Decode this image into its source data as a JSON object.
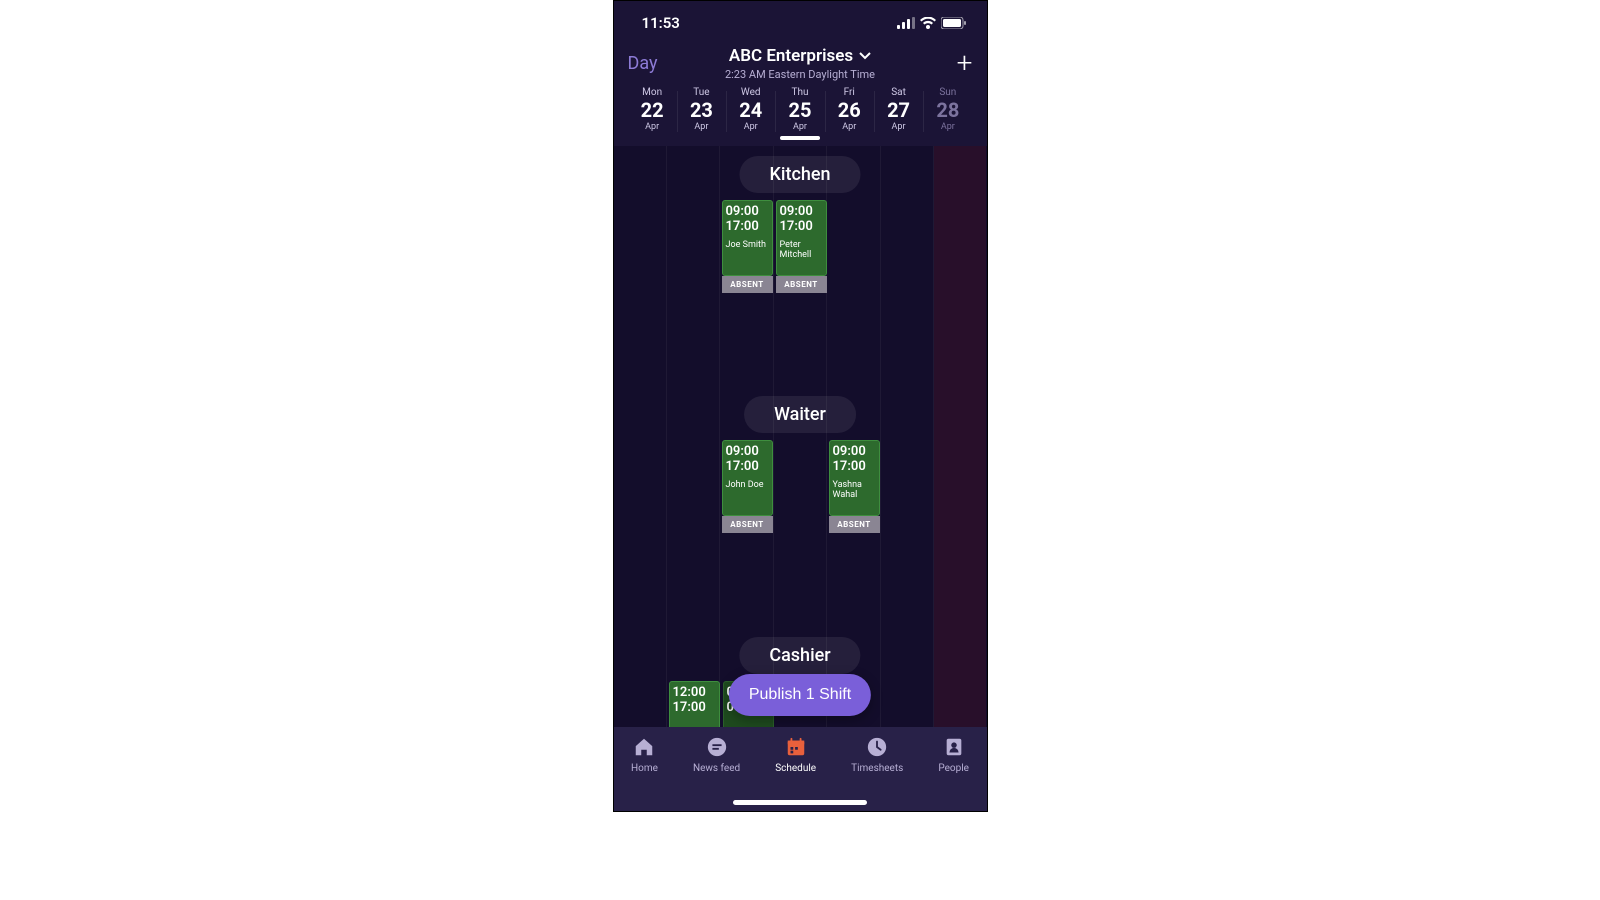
{
  "status": {
    "time": "11:53"
  },
  "header": {
    "view": "Day",
    "company": "ABC Enterprises",
    "subtime": "2:23 AM Eastern Daylight Time"
  },
  "days": [
    {
      "dow": "Mon",
      "num": "22",
      "mon": "Apr"
    },
    {
      "dow": "Tue",
      "num": "23",
      "mon": "Apr"
    },
    {
      "dow": "Wed",
      "num": "24",
      "mon": "Apr"
    },
    {
      "dow": "Thu",
      "num": "25",
      "mon": "Apr"
    },
    {
      "dow": "Fri",
      "num": "26",
      "mon": "Apr"
    },
    {
      "dow": "Sat",
      "num": "27",
      "mon": "Apr"
    },
    {
      "dow": "Sun",
      "num": "28",
      "mon": "Apr"
    }
  ],
  "sections": {
    "kitchen": "Kitchen",
    "waiter": "Waiter",
    "cashier": "Cashier"
  },
  "shifts": {
    "k1": {
      "start": "09:00",
      "end": "17:00",
      "name": "Joe Smith"
    },
    "k2": {
      "start": "09:00",
      "end": "17:00",
      "name": "Peter Mitchell"
    },
    "w1": {
      "start": "09:00",
      "end": "17:00",
      "name": "John Doe"
    },
    "w2": {
      "start": "09:00",
      "end": "17:00",
      "name": "Yashna Wahal"
    },
    "c1": {
      "start": "12:00",
      "end": "17:00"
    },
    "c2": {
      "start": "00:00",
      "end": "00:36"
    }
  },
  "absent_label": "ABSENT",
  "publish_label": "Publish 1 Shift",
  "tabs": {
    "home": "Home",
    "news": "News feed",
    "schedule": "Schedule",
    "timesheets": "Timesheets",
    "people": "People"
  }
}
